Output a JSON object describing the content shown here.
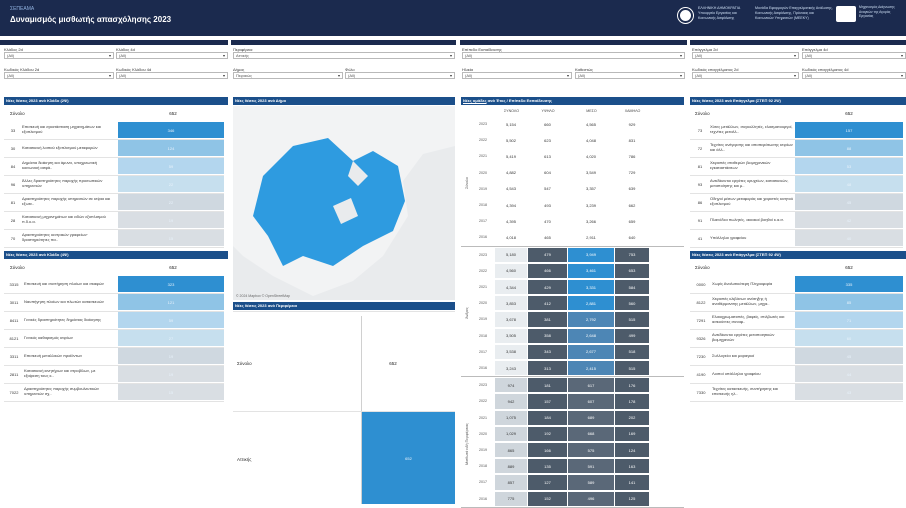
{
  "header": {
    "dashboard_label": "ΣΕΠΕΑΜΑ",
    "title": "Δυναμισμός μισθωτής απασχόλησης 2023",
    "org1": "ΕΛΛΗΝΙΚΗ ΔΗΜΟΚΡΑΤΙΑ Υπουργείο Εργασίας και Κοινωνικής Ασφάλισης",
    "org2": "Μονάδα Εφαρμογών Επαγγελματικής Ανάλυσης, Κοινωνικής Ασφάλισης, Πρόνοιας και Κοινωνικών Υπηρεσιών (ΜΕΕΚΥ)",
    "org3": "Μηχανισμός Διάγνωσης Αναγκών της Αγοράς Εργασίας"
  },
  "filters": [
    {
      "label": "Κλάδος 2d",
      "value": "(All)"
    },
    {
      "label": "Κλάδος 4d",
      "value": "(All)"
    },
    {
      "label": "Κωδικός Κλάδου 2d",
      "value": "(All)"
    },
    {
      "label": "Κωδικός Κλάδου 4d",
      "value": "(All)"
    },
    {
      "label": "Περιφέρεια",
      "value": "Αττικής"
    },
    {
      "label": "Δήμος",
      "value": "Πειραιώς"
    },
    {
      "label": "Φύλο",
      "value": "(All)"
    },
    {
      "label": "Επίπεδο Εκπαίδευσης",
      "value": "(All)"
    },
    {
      "label": "Ηλικία",
      "value": "(All)"
    },
    {
      "label": "Καθεστώς",
      "value": "(All)"
    },
    {
      "label": "Επάγγελμα 2d",
      "value": "(All)"
    },
    {
      "label": "Επάγγελμα 4d",
      "value": "(All)"
    },
    {
      "label": "Κωδικός επαγγέλματος 2d",
      "value": "(All)"
    },
    {
      "label": "Κωδικός επαγγέλματος 4d",
      "value": "(All)"
    }
  ],
  "panels": {
    "sector2d": "Νέες θέσεις 2023 ανά Κλάδο (2Ψ)",
    "sector4d": "Νέες θέσεις 2023 ανά Κλάδο (4Ψ)",
    "municipality": "Νέες θέσεις 2023 ανά Δήμο",
    "region": "Νέες θέσεις 2023 ανά Περιφέρεια",
    "edu_prefix": "Νέες ομάδες",
    "edu_suffix": "ανά Έτος / Επίπεδο Εκπαίδευσης",
    "occ2d": "Νέες θέσεις 2023 ανά Επάγγελμα (ΣΤΕΠ 92 2Ψ)",
    "occ4d": "Νέες θέσεις 2023 ανά Επάγγελμα (ΣΤΕΠ 92 4Ψ)"
  },
  "total_label": "Σύνολο",
  "total_value": "652",
  "sector2d_rows": [
    {
      "code": "33",
      "name": "Επισκευή και εγκατάσταση μηχανημάτων και εξοπλισμού",
      "value": "346"
    },
    {
      "code": "30",
      "name": "Κατασκευή λοιπού εξοπλισμού μεταφορών",
      "value": "124"
    },
    {
      "code": "84",
      "name": "Δημόσια διοίκηση και άμυνα, υποχρεωτική κοινωνική ασφά..",
      "value": "59"
    },
    {
      "code": "96",
      "name": "Άλλες δραστηριότητες παροχής προσωπικών υπηρεσιών",
      "value": "22"
    },
    {
      "code": "81",
      "name": "Δραστηριότητες παροχής υπηρεσιών σε κτίρια και εξωτε..",
      "value": "22"
    },
    {
      "code": "28",
      "name": "Κατασκευή μηχανημάτων και ειδών εξοπλισμού π.δ.κ.α.",
      "value": "19"
    },
    {
      "code": "70",
      "name": "Δραστηριότητες κεντρικών γραφείων· δραστηριότητες πα..",
      "value": "15"
    }
  ],
  "sector4d_rows": [
    {
      "code": "3315",
      "name": "Επισκευή και συντήρηση πλοίων και σκαφών",
      "value": "323"
    },
    {
      "code": "3011",
      "name": "Ναυπήγηση πλοίων και πλωτών κατασκευών",
      "value": "121"
    },
    {
      "code": "8411",
      "name": "Γενικές δραστηριότητες δημόσιας διοίκησης",
      "value": "59"
    },
    {
      "code": "8121",
      "name": "Γενικός καθαρισμός κτιρίων",
      "value": "27"
    },
    {
      "code": "3311",
      "name": "Επισκευή μεταλλικών προϊόντων",
      "value": "19"
    },
    {
      "code": "2811",
      "name": "Κατασκευή κινητήρων και στροβίλων, με εξαίρεση τους κ..",
      "value": "19"
    },
    {
      "code": "7022",
      "name": "Δραστηριότητες παροχής συμβουλευτικών υπηρεσιών σχ..",
      "value": "15"
    }
  ],
  "map_credit": "© 2024 Mapbox © OpenStreetMap",
  "region_rows": [
    {
      "name": "Αττικής",
      "value": "652"
    }
  ],
  "edu_headers": [
    "ΣΥΝΟΛΟ",
    "ΥΨΗΛΟ",
    "ΜΕΣΟ",
    "ΧΑΜΗΛΟ"
  ],
  "edu_groups": [
    {
      "label": "Σύνολο",
      "rows": [
        [
          "2023",
          "5,154",
          "660",
          "4,565",
          "929"
        ],
        [
          "2022",
          "5,502",
          "623",
          "4,048",
          "831"
        ],
        [
          "2021",
          "5,419",
          "613",
          "4,020",
          "786"
        ],
        [
          "2020",
          "4,882",
          "604",
          "3,549",
          "729"
        ],
        [
          "2019",
          "4,543",
          "547",
          "3,357",
          "639"
        ],
        [
          "2018",
          "4,394",
          "493",
          "3,239",
          "662"
        ],
        [
          "2017",
          "4,395",
          "470",
          "3,266",
          "659"
        ],
        [
          "2016",
          "4,018",
          "465",
          "2,911",
          "640"
        ]
      ]
    },
    {
      "label": "Άνδρες",
      "rows": [
        [
          "2023",
          "5,180",
          "479",
          "3,949",
          "753"
        ],
        [
          "2022",
          "4,560",
          "466",
          "3,461",
          "653"
        ],
        [
          "2021",
          "4,344",
          "429",
          "3,331",
          "584"
        ],
        [
          "2020",
          "3,853",
          "412",
          "2,881",
          "560"
        ],
        [
          "2019",
          "3,678",
          "381",
          "2,792",
          "515"
        ],
        [
          "2018",
          "3,505",
          "358",
          "2,648",
          "499"
        ],
        [
          "2017",
          "3,538",
          "343",
          "2,677",
          "518"
        ],
        [
          "2016",
          "3,243",
          "313",
          "2,415",
          "515"
        ]
      ]
    },
    {
      "label": "Μισθωτά ειδή Περιφέρειας",
      "rows": [
        [
          "2023",
          "974",
          "181",
          "617",
          "176"
        ],
        [
          "2022",
          "942",
          "157",
          "607",
          "178"
        ],
        [
          "2021",
          "1,075",
          "184",
          "689",
          "202"
        ],
        [
          "2020",
          "1,029",
          "192",
          "668",
          "169"
        ],
        [
          "2019",
          "865",
          "166",
          "575",
          "124"
        ],
        [
          "2018",
          "889",
          "135",
          "591",
          "163"
        ],
        [
          "2017",
          "857",
          "127",
          "589",
          "141"
        ],
        [
          "2016",
          "775",
          "152",
          "496",
          "125"
        ]
      ]
    }
  ],
  "occ2d_rows": [
    {
      "code": "73",
      "name": "Χύτες μετάλλων, συγκολλητές, ελασματουργοί, τεχνίτες μεταλλ..",
      "value": "157"
    },
    {
      "code": "72",
      "name": "Τεχνίτες ανέγερσης και αποπεράτωσης κτιρίων και άλλ..",
      "value": "88"
    },
    {
      "code": "81",
      "name": "Χειριστές σταθερών βιομηχανικών εγκαταστάσεων",
      "value": "53"
    },
    {
      "code": "93",
      "name": "Ανειδίκευτοι εργάτες ορυχείων, κατασκευών, μεταποίησης και μ..",
      "value": "48"
    },
    {
      "code": "86",
      "name": "Οδηγοί μέσων μεταφοράς και χειριστές κινητού εξοπλισμού",
      "value": "45"
    },
    {
      "code": "91",
      "name": "Πλανόδιοι πωλητές, οικιακοί βοηθοί κ.α.σ.",
      "value": "42"
    },
    {
      "code": "41",
      "name": "Υπάλληλοι γραφείου",
      "value": "40"
    }
  ],
  "occ4d_rows": [
    {
      "code": "0000",
      "name": "Χωρίς Αναλυτικότερη Πληροφορία",
      "value": "335"
    },
    {
      "code": "8122",
      "name": "Χειριστές κλιβάνων ανάτηξης ή αναθέρμανσης μετάλλων, μηχα..",
      "value": "85"
    },
    {
      "code": "7291",
      "name": "Ελαιοχρωματιστές, βαφείς, στιλβωτές και ασκούντες συναφ..",
      "value": "71"
    },
    {
      "code": "9326",
      "name": "Ανειδίκευτοι εργάτες μεταποιητικών βιομηχανιών",
      "value": "60"
    },
    {
      "code": "7230",
      "name": "Συλλογείοι και μαραγκοί",
      "value": "45"
    },
    {
      "code": "4190",
      "name": "Λοιποί υπάλληλοι γραφείου",
      "value": "44"
    },
    {
      "code": "7330",
      "name": "Τεχνίτες κατασκευής, συντήρησης και επισκευής ηλ..",
      "value": "43"
    }
  ]
}
